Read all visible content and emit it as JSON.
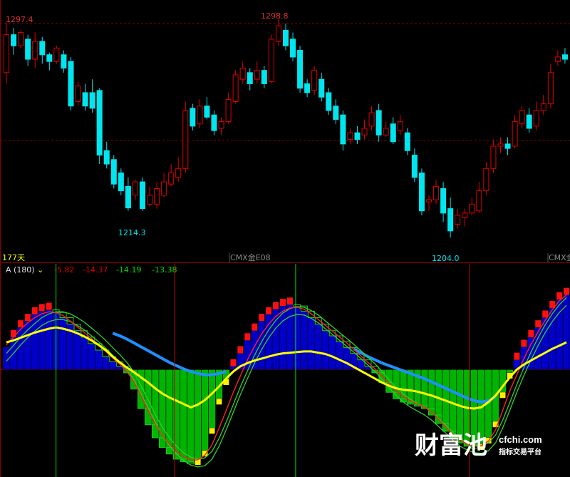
{
  "chart_data": [
    {
      "type": "candlestick",
      "colors": {
        "up": "#e00000",
        "down": "#00e5ee",
        "background": "#000000",
        "grid": "#8b0000"
      },
      "high_label": "1297.4",
      "high_label_2": "1298.8",
      "low_label": "1214.3",
      "low_label_2": "1204.0",
      "period_label": "177天",
      "bottom_labels": [
        "CMX金E08",
        "CMX金"
      ],
      "y_range": [
        1195,
        1305
      ],
      "series": [
        [
          1275,
          1292,
          1297.4,
          1270
        ],
        [
          1292,
          1287,
          1295,
          1283
        ],
        [
          1287,
          1293,
          1294,
          1286
        ],
        [
          1290,
          1281,
          1292,
          1278
        ],
        [
          1281,
          1289,
          1293,
          1277
        ],
        [
          1289,
          1283,
          1291,
          1279
        ],
        [
          1283,
          1280,
          1284,
          1276
        ],
        [
          1280,
          1286,
          1287,
          1279
        ],
        [
          1283,
          1277,
          1285,
          1275
        ],
        [
          1280,
          1260,
          1282,
          1258
        ],
        [
          1262,
          1269,
          1271,
          1260
        ],
        [
          1266,
          1260,
          1270,
          1258
        ],
        [
          1266,
          1259,
          1272,
          1257
        ],
        [
          1267,
          1238,
          1268,
          1234
        ],
        [
          1240,
          1234,
          1244,
          1232
        ],
        [
          1236,
          1225,
          1238,
          1223
        ],
        [
          1230,
          1222,
          1232,
          1220
        ],
        [
          1224,
          1214.3,
          1228,
          1213
        ],
        [
          1220,
          1226,
          1227,
          1218
        ],
        [
          1226,
          1214,
          1228,
          1213
        ],
        [
          1216,
          1220,
          1224,
          1215
        ],
        [
          1216,
          1223,
          1226,
          1214
        ],
        [
          1220,
          1226,
          1230,
          1219
        ],
        [
          1225,
          1230,
          1234,
          1224
        ],
        [
          1228,
          1232,
          1237,
          1226
        ],
        [
          1232,
          1258,
          1262,
          1230
        ],
        [
          1259,
          1251,
          1261,
          1249
        ],
        [
          1252,
          1260,
          1263,
          1250
        ],
        [
          1260,
          1255,
          1264,
          1254
        ],
        [
          1256,
          1249,
          1258,
          1247
        ],
        [
          1250,
          1253,
          1255,
          1247
        ],
        [
          1253,
          1263,
          1266,
          1252
        ],
        [
          1262,
          1274,
          1276,
          1261
        ],
        [
          1272,
          1277,
          1280,
          1270
        ],
        [
          1275,
          1270,
          1277,
          1267
        ],
        [
          1272,
          1276,
          1280,
          1270
        ],
        [
          1276,
          1270,
          1278,
          1268
        ],
        [
          1271,
          1290,
          1292,
          1270
        ],
        [
          1289,
          1296,
          1298.8,
          1287
        ],
        [
          1294,
          1287,
          1297,
          1285
        ],
        [
          1290,
          1282,
          1293,
          1280
        ],
        [
          1285,
          1268,
          1287,
          1266
        ],
        [
          1270,
          1266,
          1272,
          1264
        ],
        [
          1267,
          1276,
          1278,
          1265
        ],
        [
          1272,
          1264,
          1275,
          1262
        ],
        [
          1266,
          1258,
          1268,
          1256
        ],
        [
          1260,
          1254,
          1263,
          1252
        ],
        [
          1256,
          1243,
          1258,
          1240
        ],
        [
          1245,
          1248,
          1250,
          1243
        ],
        [
          1248,
          1245,
          1251,
          1243
        ],
        [
          1247,
          1250,
          1254,
          1245
        ],
        [
          1251,
          1257,
          1260,
          1249
        ],
        [
          1258,
          1247,
          1261,
          1244
        ],
        [
          1247,
          1250,
          1253,
          1246
        ],
        [
          1252,
          1244,
          1255,
          1243
        ],
        [
          1249,
          1253,
          1256,
          1247
        ],
        [
          1248,
          1240,
          1250,
          1238
        ],
        [
          1238,
          1228,
          1241,
          1226
        ],
        [
          1230,
          1213,
          1232,
          1211
        ],
        [
          1217,
          1218,
          1220,
          1213
        ],
        [
          1218,
          1224,
          1227,
          1216
        ],
        [
          1223,
          1212,
          1226,
          1208
        ],
        [
          1214,
          1204.0,
          1219,
          1201
        ],
        [
          1207,
          1211,
          1214,
          1205
        ],
        [
          1210,
          1212,
          1214,
          1206
        ],
        [
          1212,
          1216,
          1219,
          1211
        ],
        [
          1213,
          1222,
          1226,
          1212
        ],
        [
          1222,
          1232,
          1235,
          1220
        ],
        [
          1232,
          1242,
          1245,
          1230
        ],
        [
          1242,
          1243,
          1246,
          1239
        ],
        [
          1243,
          1241,
          1246,
          1238
        ],
        [
          1242,
          1253,
          1256,
          1241
        ],
        [
          1252,
          1258,
          1260,
          1250
        ],
        [
          1256,
          1250,
          1259,
          1248
        ],
        [
          1251,
          1258,
          1262,
          1249
        ],
        [
          1258,
          1261,
          1265,
          1256
        ],
        [
          1261,
          1275,
          1279,
          1259
        ],
        [
          1280,
          1282,
          1285,
          1278
        ],
        [
          1283,
          1281,
          1286,
          1279
        ]
      ]
    },
    {
      "type": "bar",
      "title": "A (180)",
      "title_suffix": "⌄",
      "values_text": [
        "-5.82",
        "-14.37",
        "-14.19",
        "-13.38"
      ],
      "value_colors": [
        "#e00000",
        "#e00000",
        "#00e000",
        "#00e000"
      ],
      "colors": {
        "positive": "#0000c8",
        "negative": "#00b400",
        "yellow_line": "#ffff00",
        "red_line": "#ff2020",
        "green_line": "#30d030",
        "blue_line": "#1e90ff",
        "vline_green": "#00e000",
        "vline_red": "#c00000"
      },
      "y_range": [
        -16,
        13
      ],
      "values": [
        3.5,
        5,
        6.5,
        7.5,
        8.5,
        9,
        9.2,
        8.8,
        8,
        7,
        6,
        5,
        4,
        3,
        2,
        1.2,
        0.5,
        -0.5,
        -3,
        -6,
        -8.5,
        -10.5,
        -12,
        -13,
        -13.8,
        -14.2,
        -14.37,
        -13.8,
        -12.5,
        -9,
        -4.5,
        -1.5,
        0.5,
        2.5,
        4.5,
        6,
        7.5,
        8.5,
        9.3,
        9.8,
        10,
        9.8,
        9,
        8,
        7,
        6,
        5.2,
        4.3,
        3.4,
        2.5,
        1.5,
        0.5,
        -0.5,
        -2,
        -3.5,
        -4.5,
        -5,
        -5.3,
        -5.6,
        -6,
        -7,
        -8.3,
        -9.5,
        -10.6,
        -11.3,
        -11.8,
        -11.9,
        -11.5,
        -10.5,
        -8,
        -3.5,
        -0.5,
        1.5,
        3.5,
        5,
        6.5,
        8,
        9.5,
        10.8,
        11.5
      ],
      "yellow_line": [
        4.2,
        4.5,
        4.9,
        5.3,
        5.7,
        6,
        6.3,
        6.5,
        6.3,
        6,
        5.6,
        5.1,
        4.5,
        3.8,
        3,
        2,
        1.1,
        0.3,
        -0.4,
        -1.2,
        -2,
        -2.9,
        -3.7,
        -4.3,
        -4.8,
        -5.3,
        -5.82,
        -5.4,
        -4.7,
        -3.7,
        -2.6,
        -1.4,
        -0.3,
        0.5,
        1,
        1.4,
        1.7,
        2,
        2.3,
        2.5,
        2.6,
        2.7,
        2.8,
        2.8,
        2.6,
        2.4,
        2,
        1.5,
        1,
        0.4,
        -0.2,
        -0.8,
        -1.4,
        -2,
        -2.5,
        -2.9,
        -3.1,
        -3.2,
        -3.4,
        -3.7,
        -4,
        -4.4,
        -4.8,
        -5.2,
        -5.6,
        -5.9,
        -6,
        -5.8,
        -5,
        -4,
        -2.6,
        -1.2,
        0,
        0.8,
        1.4,
        2,
        2.6,
        3.2,
        3.7,
        4.2
      ],
      "red_line": [
        3.8,
        5,
        6.2,
        7.2,
        8,
        8.6,
        8.9,
        8.8,
        8.3,
        7.5,
        6.6,
        5.7,
        4.8,
        3.8,
        2.8,
        1.8,
        0.8,
        -0.3,
        -1.9,
        -4,
        -6.3,
        -8.4,
        -10.1,
        -11.5,
        -12.6,
        -13.4,
        -13.9,
        -13.9,
        -13.2,
        -11.6,
        -9,
        -6.3,
        -3.5,
        -1,
        1.5,
        3.6,
        5.5,
        7,
        8.2,
        9,
        9.5,
        9.6,
        9.3,
        8.6,
        7.7,
        6.8,
        5.9,
        5,
        4.1,
        3.1,
        2.1,
        1.1,
        0.1,
        -1,
        -2.2,
        -3.3,
        -4.2,
        -4.8,
        -5.3,
        -5.8,
        -6.6,
        -7.7,
        -8.9,
        -10,
        -10.9,
        -11.5,
        -11.8,
        -11.7,
        -11,
        -9.3,
        -6.3,
        -3.3,
        -0.8,
        1.7,
        3.9,
        5.8,
        7.6,
        9.2,
        10.6,
        11.5
      ],
      "green_line": [
        2.5,
        3.7,
        5,
        6.1,
        7.1,
        8,
        8.6,
        8.9,
        8.9,
        8.6,
        8,
        7.3,
        6.4,
        5.5,
        4.5,
        3.4,
        2.3,
        1.1,
        -0.4,
        -2.5,
        -4.7,
        -6.9,
        -8.9,
        -10.5,
        -11.8,
        -12.8,
        -13.5,
        -13.8,
        -13.6,
        -12.6,
        -10.6,
        -8.1,
        -5.4,
        -2.7,
        -0.2,
        2.2,
        4.3,
        6.1,
        7.6,
        8.7,
        9.4,
        9.7,
        9.6,
        9.1,
        8.4,
        7.5,
        6.6,
        5.7,
        4.8,
        3.9,
        2.9,
        1.9,
        0.9,
        -0.3,
        -1.6,
        -2.8,
        -3.8,
        -4.6,
        -5.2,
        -5.8,
        -6.6,
        -7.6,
        -8.6,
        -9.7,
        -10.6,
        -11.2,
        -11.6,
        -11.7,
        -11.3,
        -10.1,
        -7.8,
        -5.1,
        -2.3,
        0.3,
        2.7,
        4.9,
        6.9,
        8.6,
        10,
        11.1
      ],
      "blue_line": [
        null,
        null,
        null,
        null,
        null,
        null,
        null,
        null,
        null,
        null,
        null,
        null,
        null,
        null,
        null,
        5.6,
        5.2,
        4.7,
        4.1,
        3.5,
        2.9,
        2.3,
        1.7,
        1.1,
        0.6,
        0.1,
        -0.3,
        -0.6,
        -0.8,
        -0.8,
        -0.6,
        -0.3,
        null,
        null,
        null,
        null,
        null,
        null,
        null,
        null,
        null,
        null,
        null,
        null,
        null,
        null,
        null,
        null,
        null,
        3.2,
        2.6,
        2,
        1.5,
        1,
        0.6,
        0.2,
        -0.2,
        -0.6,
        -1,
        -1.4,
        -1.9,
        -2.4,
        -2.9,
        -3.4,
        -3.9,
        -4.4,
        -4.8,
        -5,
        -4.8,
        -4.2,
        null,
        null,
        null,
        null,
        null,
        null,
        null,
        null,
        null,
        null
      ],
      "vlines": [
        {
          "index": 7,
          "color": "green"
        },
        {
          "index": 23.7,
          "color": "red"
        },
        {
          "index": 40.8,
          "color": "green"
        },
        {
          "index": 65.3,
          "color": "red"
        }
      ]
    }
  ],
  "watermark": {
    "cn": "财富池",
    "en": "cfchi.com",
    "sub": "指标交易平台"
  }
}
